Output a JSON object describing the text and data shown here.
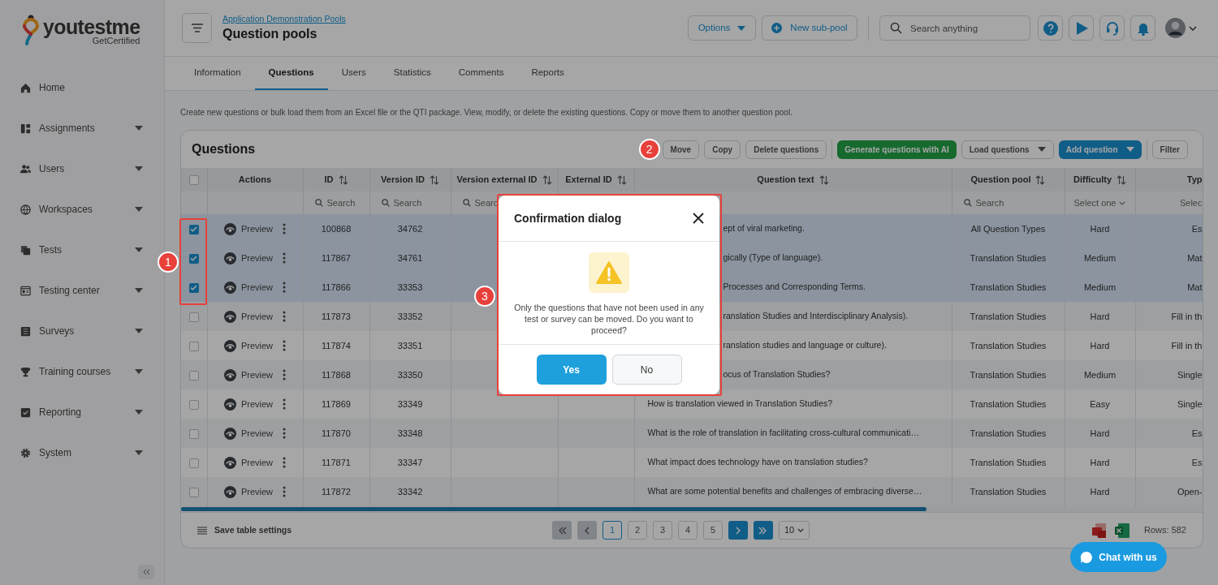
{
  "logo": {
    "name": "youtestme",
    "tagline": "GetCertified"
  },
  "sidebar": {
    "items": [
      {
        "label": "Home",
        "expandable": false
      },
      {
        "label": "Assignments",
        "expandable": true
      },
      {
        "label": "Users",
        "expandable": true
      },
      {
        "label": "Workspaces",
        "expandable": true
      },
      {
        "label": "Tests",
        "expandable": true
      },
      {
        "label": "Testing center",
        "expandable": true
      },
      {
        "label": "Surveys",
        "expandable": true
      },
      {
        "label": "Training courses",
        "expandable": true
      },
      {
        "label": "Reporting",
        "expandable": true
      },
      {
        "label": "System",
        "expandable": true
      }
    ]
  },
  "header": {
    "breadcrumb": "Application Demonstration Pools",
    "title": "Question pools",
    "options_button": "Options",
    "new_button": "New sub-pool",
    "search": {
      "placeholder": "Search anything"
    }
  },
  "tabs": [
    {
      "label": "Information",
      "selected": false
    },
    {
      "label": "Questions",
      "selected": true
    },
    {
      "label": "Users",
      "selected": false
    },
    {
      "label": "Statistics",
      "selected": false
    },
    {
      "label": "Comments",
      "selected": false
    },
    {
      "label": "Reports",
      "selected": false
    }
  ],
  "description": "Create new questions or bulk load them from an Excel file or the QTI package. View, modify, or delete the existing questions. Copy or move them to another question pool.",
  "card": {
    "title": "Questions",
    "toolbar": [
      {
        "label": "Move",
        "kind": "plain"
      },
      {
        "label": "Copy",
        "kind": "plain"
      },
      {
        "label": "Delete questions",
        "kind": "plain"
      },
      {
        "label": "Generate questions with AI",
        "kind": "green"
      },
      {
        "label": "Load questions",
        "kind": "dropdown"
      },
      {
        "label": "Add question",
        "kind": "primary"
      },
      {
        "label": "Filter",
        "kind": "plain"
      }
    ]
  },
  "table": {
    "all_selected": false,
    "columns": [
      {
        "label": "Actions",
        "sortable": false
      },
      {
        "label": "ID",
        "sortable": true,
        "placeholder": "Search"
      },
      {
        "label": "Version ID",
        "sortable": true,
        "placeholder": "Search"
      },
      {
        "label": "Version external ID",
        "sortable": true,
        "placeholder": "Searc"
      },
      {
        "label": "External ID",
        "sortable": true
      },
      {
        "label": "Question text",
        "sortable": true
      },
      {
        "label": "Question pool",
        "sortable": true,
        "placeholder": "Search"
      },
      {
        "label": "Difficulty",
        "sortable": true,
        "filter_value": "Select one"
      },
      {
        "label": "Typ",
        "sortable": false,
        "filter_value": "Selec"
      }
    ],
    "rows": [
      {
        "action_label": "Preview",
        "selected": true,
        "id": "100868",
        "version_id": "34762",
        "question_text": "ept of viral marketing.",
        "partly_hidden": true,
        "pool": "All Question Types",
        "difficulty": "Hard",
        "type": "Es"
      },
      {
        "action_label": "Preview",
        "selected": true,
        "id": "117867",
        "version_id": "34761",
        "question_text": "gically (Type of language).",
        "partly_hidden": true,
        "pool": "Translation Studies",
        "difficulty": "Medium",
        "type": "Mat"
      },
      {
        "action_label": "Preview",
        "selected": true,
        "id": "117866",
        "version_id": "33353",
        "question_text": "Processes and Corresponding Terms.",
        "partly_hidden": true,
        "pool": "Translation Studies",
        "difficulty": "Medium",
        "type": "Mat"
      },
      {
        "action_label": "Preview",
        "selected": false,
        "id": "117873",
        "version_id": "33352",
        "question_text": "ranslation Studies and Interdisciplinary Analysis).",
        "partly_hidden": true,
        "pool": "Translation Studies",
        "difficulty": "Hard",
        "type": "Fill in th"
      },
      {
        "action_label": "Preview",
        "selected": false,
        "id": "117874",
        "version_id": "33351",
        "question_text": "ranslation studies and language or culture).",
        "partly_hidden": true,
        "pool": "Translation Studies",
        "difficulty": "Hard",
        "type": "Fill in th"
      },
      {
        "action_label": "Preview",
        "selected": false,
        "id": "117868",
        "version_id": "33350",
        "question_text": "ocus of Translation Studies?",
        "partly_hidden": true,
        "pool": "Translation Studies",
        "difficulty": "Medium",
        "type": "Single"
      },
      {
        "action_label": "Preview",
        "selected": false,
        "id": "117869",
        "version_id": "33349",
        "question_text": "How is translation viewed in Translation Studies?",
        "partly_hidden": false,
        "pool": "Translation Studies",
        "difficulty": "Easy",
        "type": "Single"
      },
      {
        "action_label": "Preview",
        "selected": false,
        "id": "117870",
        "version_id": "33348",
        "question_text": "What is the role of translation in facilitating cross-cultural communicati…",
        "partly_hidden": false,
        "pool": "Translation Studies",
        "difficulty": "Hard",
        "type": "Es"
      },
      {
        "action_label": "Preview",
        "selected": false,
        "id": "117871",
        "version_id": "33347",
        "question_text": "What impact does technology have on translation studies?",
        "partly_hidden": false,
        "pool": "Translation Studies",
        "difficulty": "Hard",
        "type": "Es"
      },
      {
        "action_label": "Preview",
        "selected": false,
        "id": "117872",
        "version_id": "33342",
        "question_text": "What are some potential benefits and challenges of embracing diverse…",
        "partly_hidden": false,
        "pool": "Translation Studies",
        "difficulty": "Hard",
        "type": "Open-"
      }
    ]
  },
  "footer": {
    "save_settings": "Save table settings",
    "nav": [
      {
        "kind": "first",
        "disabled": true
      },
      {
        "kind": "prev",
        "disabled": true
      }
    ],
    "pages": [
      {
        "label": "1",
        "selected": true
      },
      {
        "label": "2",
        "selected": false
      },
      {
        "label": "3",
        "selected": false
      },
      {
        "label": "4",
        "selected": false
      },
      {
        "label": "5",
        "selected": false
      }
    ],
    "nav_after": [
      {
        "kind": "next",
        "disabled": false
      },
      {
        "kind": "last",
        "disabled": false
      }
    ],
    "rows_per_page": "10",
    "rows_count": "Rows: 582"
  },
  "chat_button": "Chat with us",
  "dialog": {
    "title": "Confirmation dialog",
    "message": "Only the questions that have not been used in any test or survey can be moved. Do you want to proceed?",
    "buttons": [
      {
        "label": "Yes",
        "kind": "primary"
      },
      {
        "label": "No",
        "kind": "secondary"
      }
    ]
  },
  "annotations": [
    {
      "label": "1"
    },
    {
      "label": "2"
    },
    {
      "label": "3"
    }
  ]
}
